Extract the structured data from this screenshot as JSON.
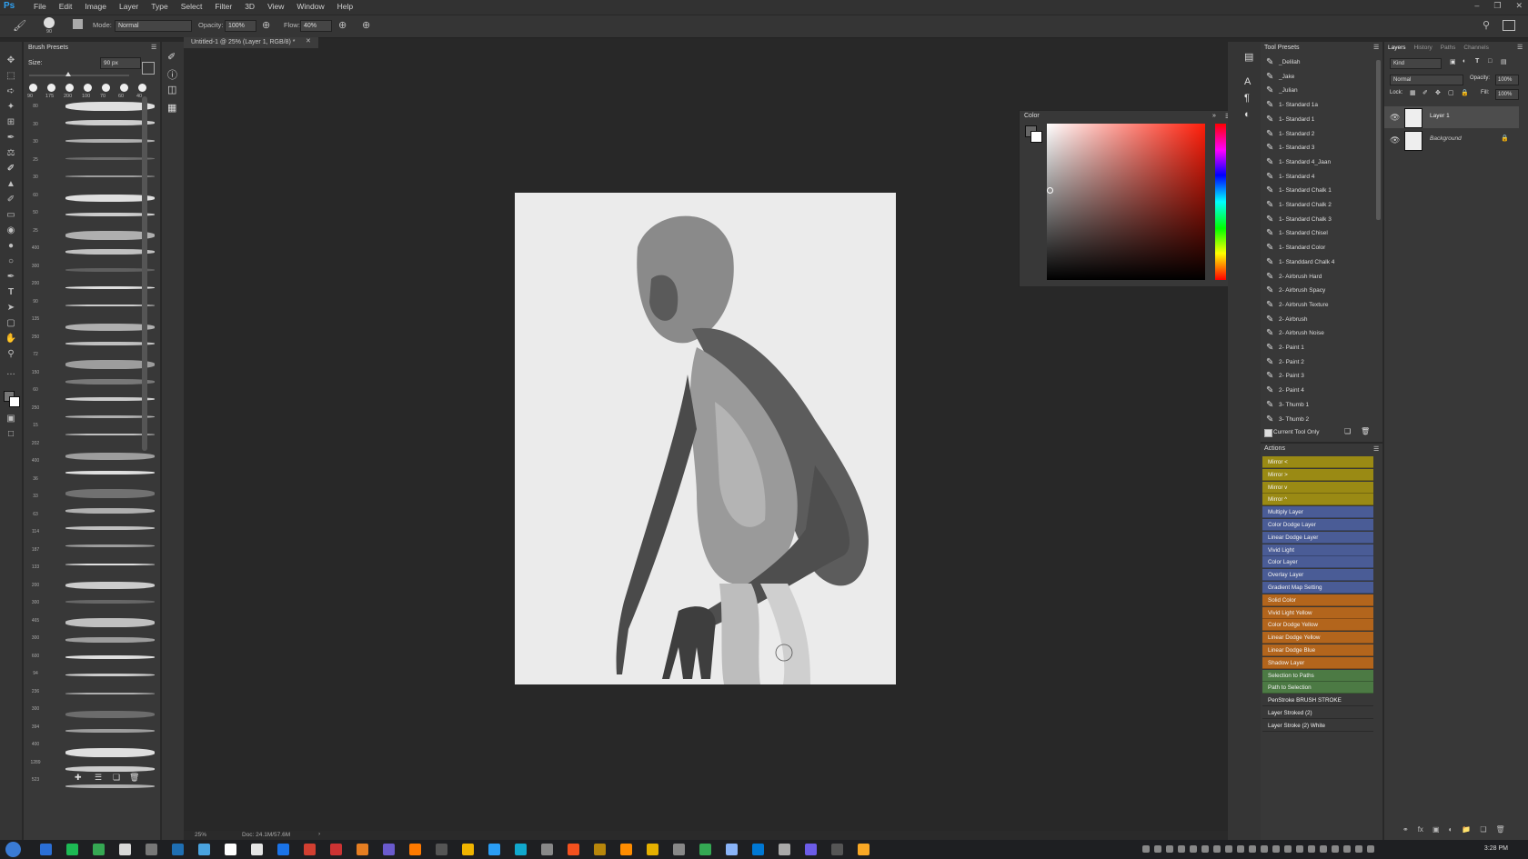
{
  "app": {
    "logo": "Ps",
    "menus": [
      "File",
      "Edit",
      "Image",
      "Layer",
      "Type",
      "Select",
      "Filter",
      "3D",
      "View",
      "Window",
      "Help"
    ]
  },
  "options": {
    "brush_size": "90",
    "mode_label": "Mode:",
    "mode_value": "Normal",
    "opacity_label": "Opacity:",
    "opacity_value": "100%",
    "flow_label": "Flow:",
    "flow_value": "40%"
  },
  "document": {
    "tab_title": "Untitled-1 @ 25% (Layer 1, RGB/8) *",
    "zoom": "25%",
    "doc_info": "Doc: 24.1M/57.6M"
  },
  "brush_presets": {
    "title": "Brush Presets",
    "size_label": "Size:",
    "size_value": "90 px",
    "tip_sizes": [
      "90",
      "175",
      "200",
      "100",
      "70",
      "60",
      "40"
    ],
    "sizes_column": [
      "80",
      "30",
      "30",
      "25",
      "30",
      "60",
      "50",
      "25",
      "400",
      "300",
      "200",
      "90",
      "135",
      "250",
      "72",
      "150",
      "60",
      "250",
      "15",
      "202",
      "400",
      "36",
      "33",
      "63",
      "114",
      "187",
      "133",
      "200",
      "300",
      "465",
      "300",
      "600",
      "94",
      "236",
      "300",
      "394",
      "400",
      "1289",
      "523"
    ]
  },
  "color_panel": {
    "title": "Color",
    "foreground": "#666666",
    "background": "#ffffff"
  },
  "tool_presets": {
    "title": "Tool Presets",
    "items": [
      "_Delilah",
      "_Jake",
      "_Julian",
      "1- Standard 1a",
      "1- Standard 1",
      "1- Standard 2",
      "1- Standard 3",
      "1- Standard 4_Jaan",
      "1- Standard 4",
      "1- Standard Chalk 1",
      "1- Standard Chalk 2",
      "1- Standard Chalk 3",
      "1- Standard Chisel",
      "1- Standard Color",
      "1- Standdard Chalk 4",
      "2- Airbrush Hard",
      "2- Airbrush Spacy",
      "2- Airbrush Texture",
      "2- Airbrush",
      "2- Airbrush Noise",
      "2- Paint 1",
      "2- Paint 2",
      "2- Paint 3",
      "2- Paint 4",
      "3- Thumb 1",
      "3- Thumb 2"
    ],
    "current_tool_only": "Current Tool Only"
  },
  "actions": {
    "title": "Actions",
    "items": [
      {
        "label": "Mirror <",
        "color": "#9a8a14"
      },
      {
        "label": "Mirror >",
        "color": "#9a8a14"
      },
      {
        "label": "Mirror v",
        "color": "#9a8a14"
      },
      {
        "label": "Mirror ^",
        "color": "#9a8a14"
      },
      {
        "label": "Multiply Layer",
        "color": "#4a5c96"
      },
      {
        "label": "Color Dodge Layer",
        "color": "#4a5c96"
      },
      {
        "label": "Linear Dodge Layer",
        "color": "#4a5c96"
      },
      {
        "label": "Vivid Light",
        "color": "#4a5c96"
      },
      {
        "label": "Color Layer",
        "color": "#4a5c96"
      },
      {
        "label": "Overlay Layer",
        "color": "#4a5c96"
      },
      {
        "label": "Gradient Map Setting",
        "color": "#4a5c96"
      },
      {
        "label": "Solid Color",
        "color": "#b3651c"
      },
      {
        "label": "Vivid Light Yellow",
        "color": "#b3651c"
      },
      {
        "label": "Color Dodge Yellow",
        "color": "#b3651c"
      },
      {
        "label": "Linear Dodge Yellow",
        "color": "#b3651c"
      },
      {
        "label": "Linear Dodge Blue",
        "color": "#b3651c"
      },
      {
        "label": "Shadow Layer",
        "color": "#b3651c"
      },
      {
        "label": "Selection to Paths",
        "color": "#4c7a44"
      },
      {
        "label": "Path to Selection",
        "color": "#4c7a44"
      },
      {
        "label": "PenStroke BRUSH STROKE",
        "color": "#383838"
      },
      {
        "label": "Layer Stroked (2)",
        "color": "#383838"
      },
      {
        "label": "Layer Stroke (2) White",
        "color": "#383838"
      }
    ]
  },
  "layers_panel": {
    "tabs": [
      "Layers",
      "History",
      "Paths",
      "Channels"
    ],
    "kind": "Kind",
    "blend_mode": "Normal",
    "opacity_label": "Opacity:",
    "opacity_value": "100%",
    "lock_label": "Lock:",
    "fill_label": "Fill:",
    "fill_value": "100%",
    "layers": [
      "Layer 1",
      "Background"
    ]
  },
  "taskbar": {
    "clock": "3:28 PM"
  }
}
